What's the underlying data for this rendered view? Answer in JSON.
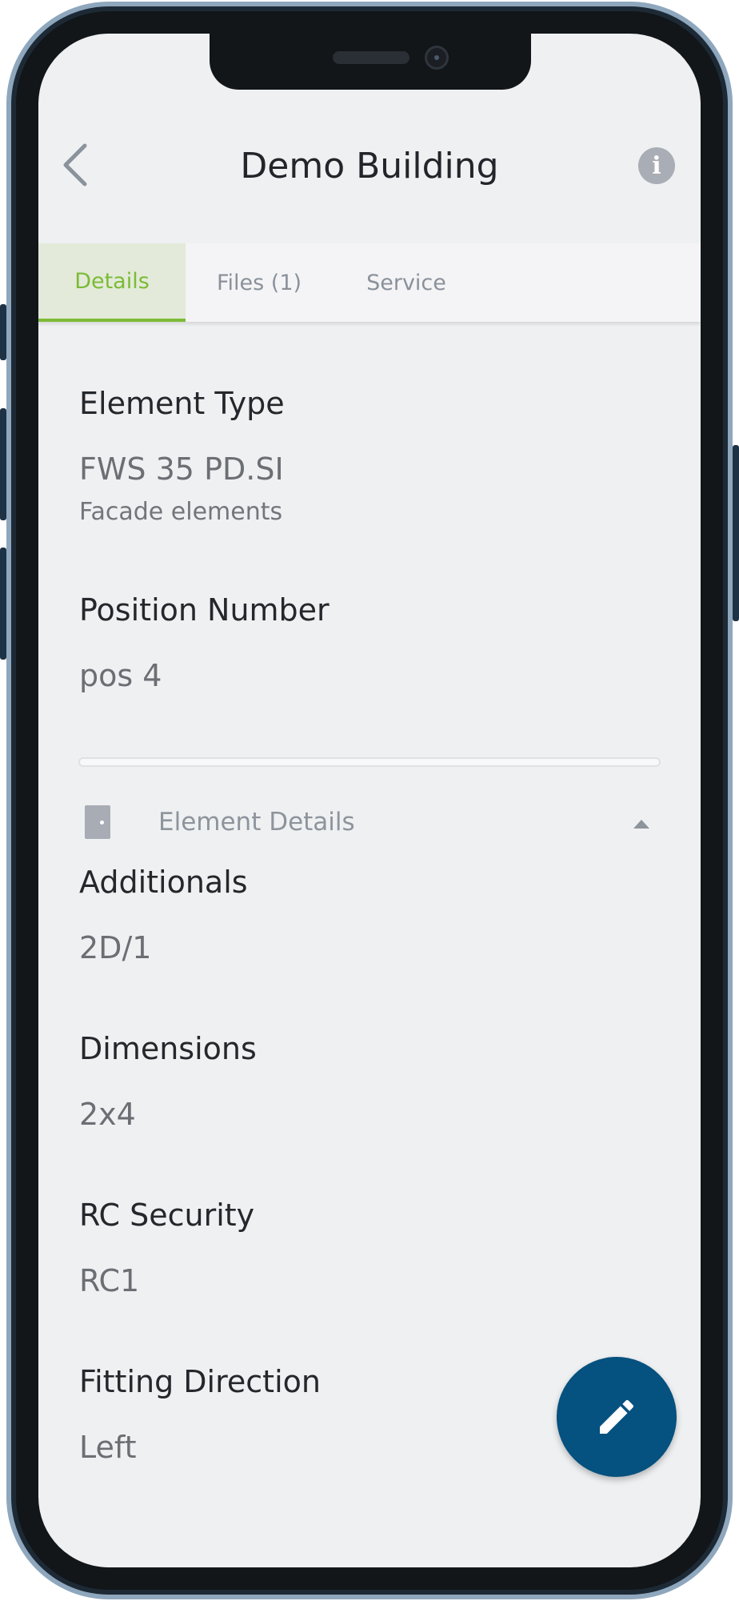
{
  "header": {
    "title": "Demo Building",
    "back_icon": "chevron-left-icon",
    "info_icon": "info-icon",
    "info_glyph": "i"
  },
  "tabs": [
    {
      "label": "Details",
      "active": true
    },
    {
      "label": "Files (1)",
      "active": false
    },
    {
      "label": "Service",
      "active": false
    }
  ],
  "details": {
    "element_type": {
      "label": "Element Type",
      "value": "FWS 35 PD.SI",
      "sub": "Facade elements"
    },
    "position_number": {
      "label": "Position Number",
      "value": "pos 4"
    }
  },
  "element_details": {
    "title": "Element Details",
    "icon": "door-icon",
    "expanded": true,
    "fields": [
      {
        "label": "Additionals",
        "value": "2D/1"
      },
      {
        "label": "Dimensions",
        "value": "2x4"
      },
      {
        "label": "RC Security",
        "value": "RC1"
      },
      {
        "label": "Fitting Direction",
        "value": "Left"
      }
    ]
  },
  "fab": {
    "icon": "pencil-icon"
  },
  "colors": {
    "accent": "#7bbb36",
    "fab": "#05517f",
    "background": "#eff0f2"
  }
}
